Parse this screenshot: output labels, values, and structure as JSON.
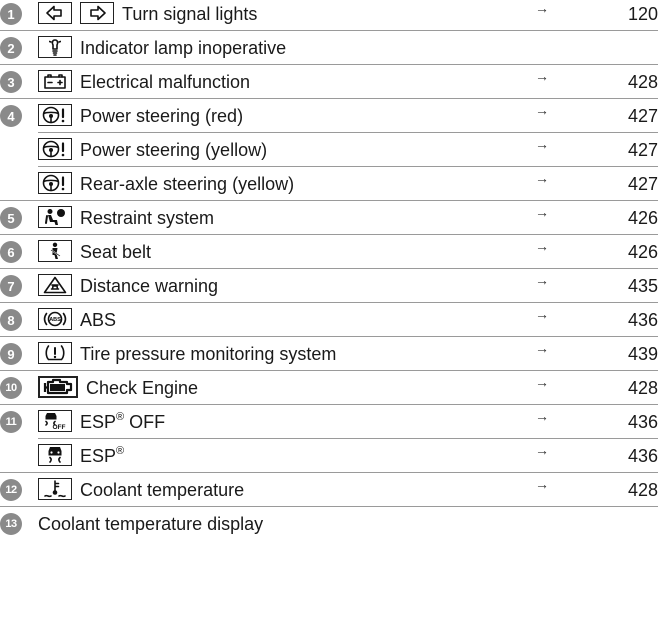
{
  "rows": [
    {
      "num": "1",
      "icons": [
        "turn-left-icon",
        "turn-right-icon"
      ],
      "label": "Turn signal lights",
      "page": "120"
    },
    {
      "num": "2",
      "icons": [
        "indicator-lamp-icon"
      ],
      "label": "Indicator lamp inoperative",
      "page": ""
    },
    {
      "num": "3",
      "icons": [
        "battery-icon"
      ],
      "label": "Electrical malfunction",
      "page": "428"
    },
    {
      "num": "4",
      "icons": [
        "steering-wheel-warning-icon"
      ],
      "label": "Power steering (red)",
      "page": "427"
    },
    {
      "num": "",
      "icons": [
        "steering-wheel-warning-icon"
      ],
      "label": "Power steering (yellow)",
      "page": "427"
    },
    {
      "num": "",
      "icons": [
        "steering-wheel-warning-icon"
      ],
      "label": "Rear-axle steering (yellow)",
      "page": "427"
    },
    {
      "num": "5",
      "icons": [
        "airbag-icon"
      ],
      "label": "Restraint system",
      "page": "426"
    },
    {
      "num": "6",
      "icons": [
        "seat-belt-icon"
      ],
      "label": "Seat belt",
      "page": "426"
    },
    {
      "num": "7",
      "icons": [
        "distance-warning-icon"
      ],
      "label": "Distance warning",
      "page": "435"
    },
    {
      "num": "8",
      "icons": [
        "abs-icon"
      ],
      "label": "ABS",
      "page": "436"
    },
    {
      "num": "9",
      "icons": [
        "tire-pressure-icon"
      ],
      "label": "Tire pressure monitoring system",
      "page": "439"
    },
    {
      "num": "10",
      "icons": [
        "check-engine-icon"
      ],
      "label": "Check Engine",
      "page": "428"
    },
    {
      "num": "11",
      "icons": [
        "esp-off-icon"
      ],
      "label": "ESP",
      "sup": "®",
      "suffix": " OFF",
      "page": "436"
    },
    {
      "num": "",
      "icons": [
        "esp-icon"
      ],
      "label": "ESP",
      "sup": "®",
      "suffix": "",
      "page": "436"
    },
    {
      "num": "12",
      "icons": [
        "coolant-temperature-icon"
      ],
      "label": "Coolant temperature",
      "page": "428"
    },
    {
      "num": "13",
      "icons": [],
      "label": "Coolant temperature display",
      "page": ""
    }
  ],
  "arrow_glyph": "→",
  "icon_text": {
    "abs": "ABS",
    "off": "OFF"
  }
}
